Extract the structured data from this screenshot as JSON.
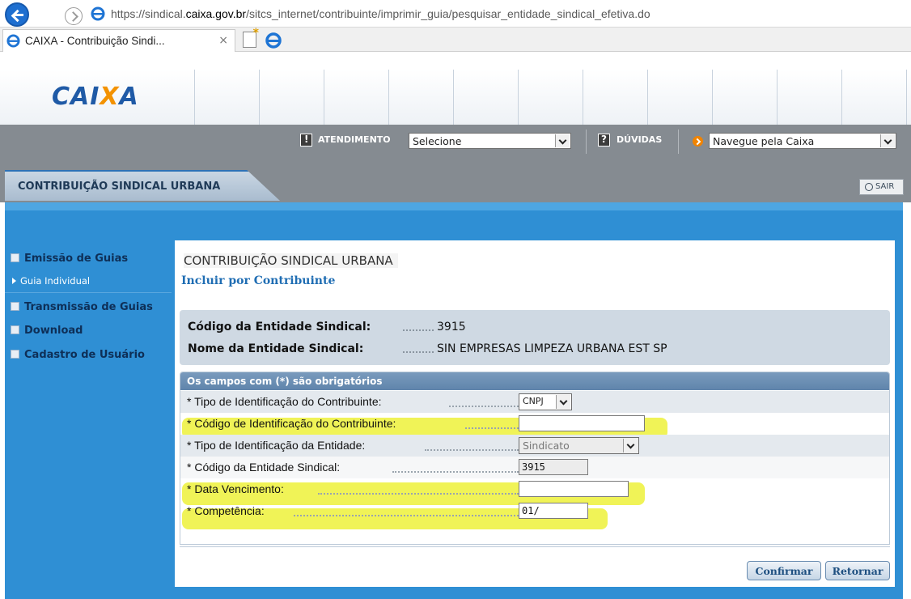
{
  "browser": {
    "url_pre": "https://sindical.",
    "url_domain": "caixa.gov.br",
    "url_path": "/sitcs_internet/contribuinte/imprimir_guia/pesquisar_entidade_sindical_efetiva.do",
    "tab_title": "CAIXA - Contribuição Sindi...",
    "tab_close": "×"
  },
  "header": {
    "logo_pre": "CAI",
    "logo_x": "X",
    "logo_post": "A",
    "atendimento_label": "ATENDIMENTO",
    "atendimento_value": "Selecione",
    "duvidas_label": "DÚVIDAS",
    "navegue_value": "Navegue pela Caixa",
    "section_tab": "CONTRIBUIÇÃO SINDICAL URBANA",
    "sair": "SAIR"
  },
  "sidebar": {
    "items": [
      {
        "label": "Emissão de Guias"
      },
      {
        "label": "Transmissão de Guias"
      },
      {
        "label": "Download"
      },
      {
        "label": "Cadastro de Usuário"
      }
    ],
    "sub_item": "Guia Individual"
  },
  "content": {
    "title": "CONTRIBUIÇÃO SINDICAL URBANA",
    "subtitle": "Incluir por Contribuinte",
    "codigo_label": "Código da Entidade Sindical:",
    "codigo_value": "3915",
    "nome_label": "Nome da Entidade Sindical:",
    "nome_value": "SIN EMPRESAS LIMPEZA URBANA EST SP"
  },
  "form": {
    "header": "Os campos com (*) são obrigatórios",
    "rows": [
      {
        "label": "* Tipo de Identificação do Contribuinte:",
        "value": "CNPJ"
      },
      {
        "label": "* Código de Identificação do Contribuinte:",
        "value": ""
      },
      {
        "label": "* Tipo de Identificação da Entidade:",
        "value": "Sindicato"
      },
      {
        "label": "* Código da Entidade Sindical:",
        "value": "3915"
      },
      {
        "label": "* Data Vencimento:",
        "value": ""
      },
      {
        "label": "* Competência:",
        "value": "01/"
      }
    ]
  },
  "buttons": {
    "confirmar": "Confirmar",
    "retornar": "Retornar"
  },
  "colors": {
    "brand_blue": "#1f5aa6",
    "brand_orange": "#f39200",
    "area_blue": "#2f8fd4",
    "highlight": "#ecf028"
  }
}
